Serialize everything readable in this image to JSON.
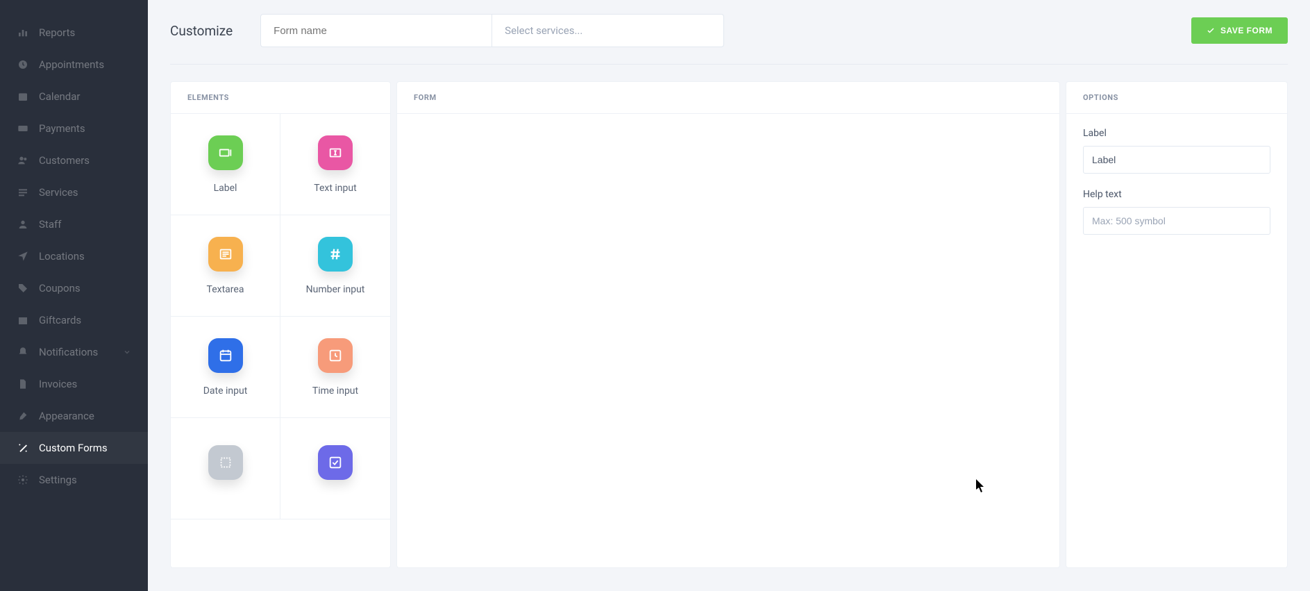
{
  "sidebar": {
    "items": [
      {
        "label": "Reports",
        "icon": "chart"
      },
      {
        "label": "Appointments",
        "icon": "clock"
      },
      {
        "label": "Calendar",
        "icon": "calendar"
      },
      {
        "label": "Payments",
        "icon": "card"
      },
      {
        "label": "Customers",
        "icon": "users"
      },
      {
        "label": "Services",
        "icon": "list"
      },
      {
        "label": "Staff",
        "icon": "user"
      },
      {
        "label": "Locations",
        "icon": "location"
      },
      {
        "label": "Coupons",
        "icon": "tag"
      },
      {
        "label": "Giftcards",
        "icon": "gift"
      },
      {
        "label": "Notifications",
        "icon": "bell",
        "expandable": true
      },
      {
        "label": "Invoices",
        "icon": "file"
      },
      {
        "label": "Appearance",
        "icon": "brush"
      },
      {
        "label": "Custom Forms",
        "icon": "magic",
        "active": true
      },
      {
        "label": "Settings",
        "icon": "gear"
      }
    ]
  },
  "header": {
    "title": "Customize",
    "form_name_placeholder": "Form name",
    "service_placeholder": "Select services...",
    "save_label": "SAVE FORM"
  },
  "panels": {
    "elements_title": "ELEMENTS",
    "form_title": "FORM",
    "options_title": "OPTIONS"
  },
  "elements": [
    {
      "label": "Label",
      "color": "#6cce54",
      "glyph": "label"
    },
    {
      "label": "Text input",
      "color": "#e957a4",
      "glyph": "textcursor"
    },
    {
      "label": "Textarea",
      "color": "#f7b14f",
      "glyph": "lines"
    },
    {
      "label": "Number input",
      "color": "#33c3dc",
      "glyph": "hash"
    },
    {
      "label": "Date input",
      "color": "#2f6fe8",
      "glyph": "calendar"
    },
    {
      "label": "Time input",
      "color": "#f79b7a",
      "glyph": "clocksq"
    },
    {
      "label": "",
      "color": "#c3c9d1",
      "glyph": "select"
    },
    {
      "label": "",
      "color": "#6d6ae8",
      "glyph": "check"
    }
  ],
  "options": {
    "label_field_label": "Label",
    "label_field_value": "Label",
    "help_field_label": "Help text",
    "help_field_placeholder": "Max: 500 symbol"
  }
}
